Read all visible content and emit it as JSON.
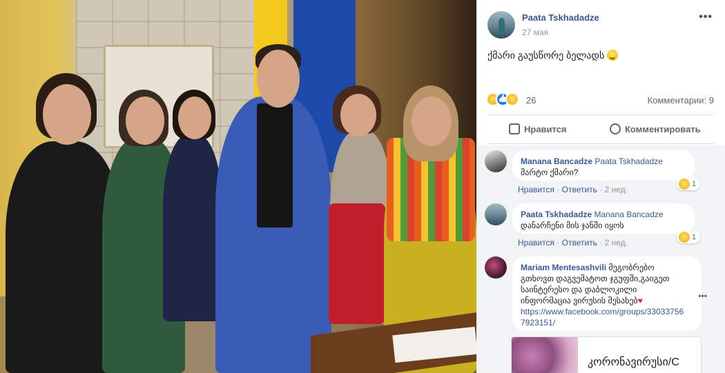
{
  "post": {
    "author": "Paata Tskhadadze",
    "date": "27 мая",
    "text": "ქმარი გაუსწორე ბელადს",
    "more": "•••",
    "reactions_count": "26",
    "comments_count": "Комментарии: 9"
  },
  "actions": {
    "like_label": "Нравится",
    "comment_label": "Комментировать"
  },
  "comments": [
    {
      "author": "Manana Bancadze",
      "mention": "Paata Tskhadadze",
      "text": "მარტო ქმარი?",
      "like": "Нравится",
      "sep": "·",
      "reply": "Ответить",
      "time": "2 нед.",
      "reaction_count": "1"
    },
    {
      "author": "Paata Tskhadadze",
      "mention": "Manana Bancadze",
      "text": "დანარჩენი მის ჯანში იყოს",
      "like": "Нравится",
      "sep": "·",
      "reply": "Ответить",
      "time": "2 нед.",
      "reaction_count": "1"
    },
    {
      "author": "Mariam Mentesashvili",
      "text_line1": "მეგობრებო",
      "text_line2": "გთხოვთ დაგვემატოთ ჯგუფში,გაიგეთ",
      "text_line3": "საინტერესო და დაბლოკილი",
      "text_line4": "ინფორმაცია ვირუსის შესახებ",
      "link_line1": "https://www.facebook.com/groups/33033756",
      "link_line2": "7923151/",
      "more": "•••",
      "link_card_title": "კორონავირუსი/C"
    }
  ],
  "colors": {
    "link": "#385898",
    "meta": "#90949c",
    "comments_bg": "#f2f3f5",
    "like_blue": "#2078f4"
  }
}
